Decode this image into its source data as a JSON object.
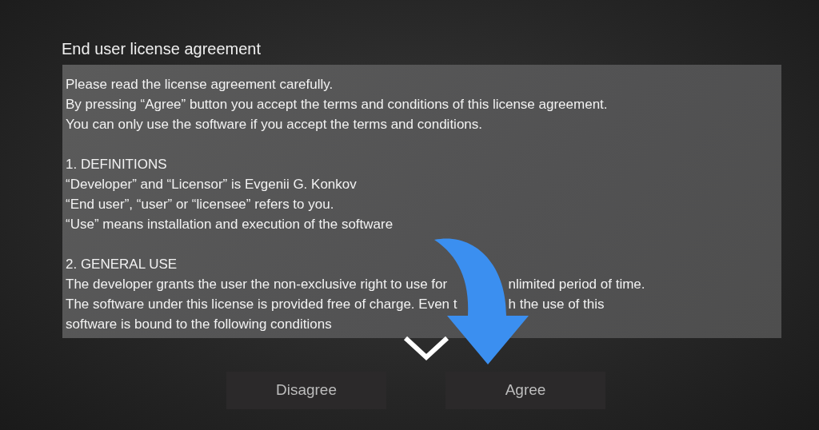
{
  "title": "End user license agreement",
  "license_lines": [
    {
      "segments": [
        "Please read the license agreement carefully."
      ]
    },
    {
      "segments": [
        "By pressing “Agree” button you accept the terms and conditions of this license agreement."
      ]
    },
    {
      "segments": [
        "You can only use the software if you accept the terms and conditions."
      ]
    },
    {
      "kind": "blank"
    },
    {
      "segments": [
        "1. DEFINITIONS"
      ]
    },
    {
      "segments": [
        "“Developer” and “Licensor” is Evgenii G. Konkov"
      ]
    },
    {
      "segments": [
        "“End user”, “user” or “licensee” refers to you."
      ]
    },
    {
      "segments": [
        "“Use” means installation and execution of the software"
      ]
    },
    {
      "kind": "blank"
    },
    {
      "segments": [
        "2. GENERAL USE"
      ]
    },
    {
      "segments": [
        "The developer grants the user the non-exclusive right to use for",
        "nlimited period of time."
      ]
    },
    {
      "segments": [
        "The software under this license is provided free of charge. Even t",
        "h the use of this"
      ]
    },
    {
      "segments": [
        "software is bound to the following conditions"
      ]
    }
  ],
  "buttons": [
    {
      "label": "Disagree"
    },
    {
      "label": "Agree"
    }
  ]
}
